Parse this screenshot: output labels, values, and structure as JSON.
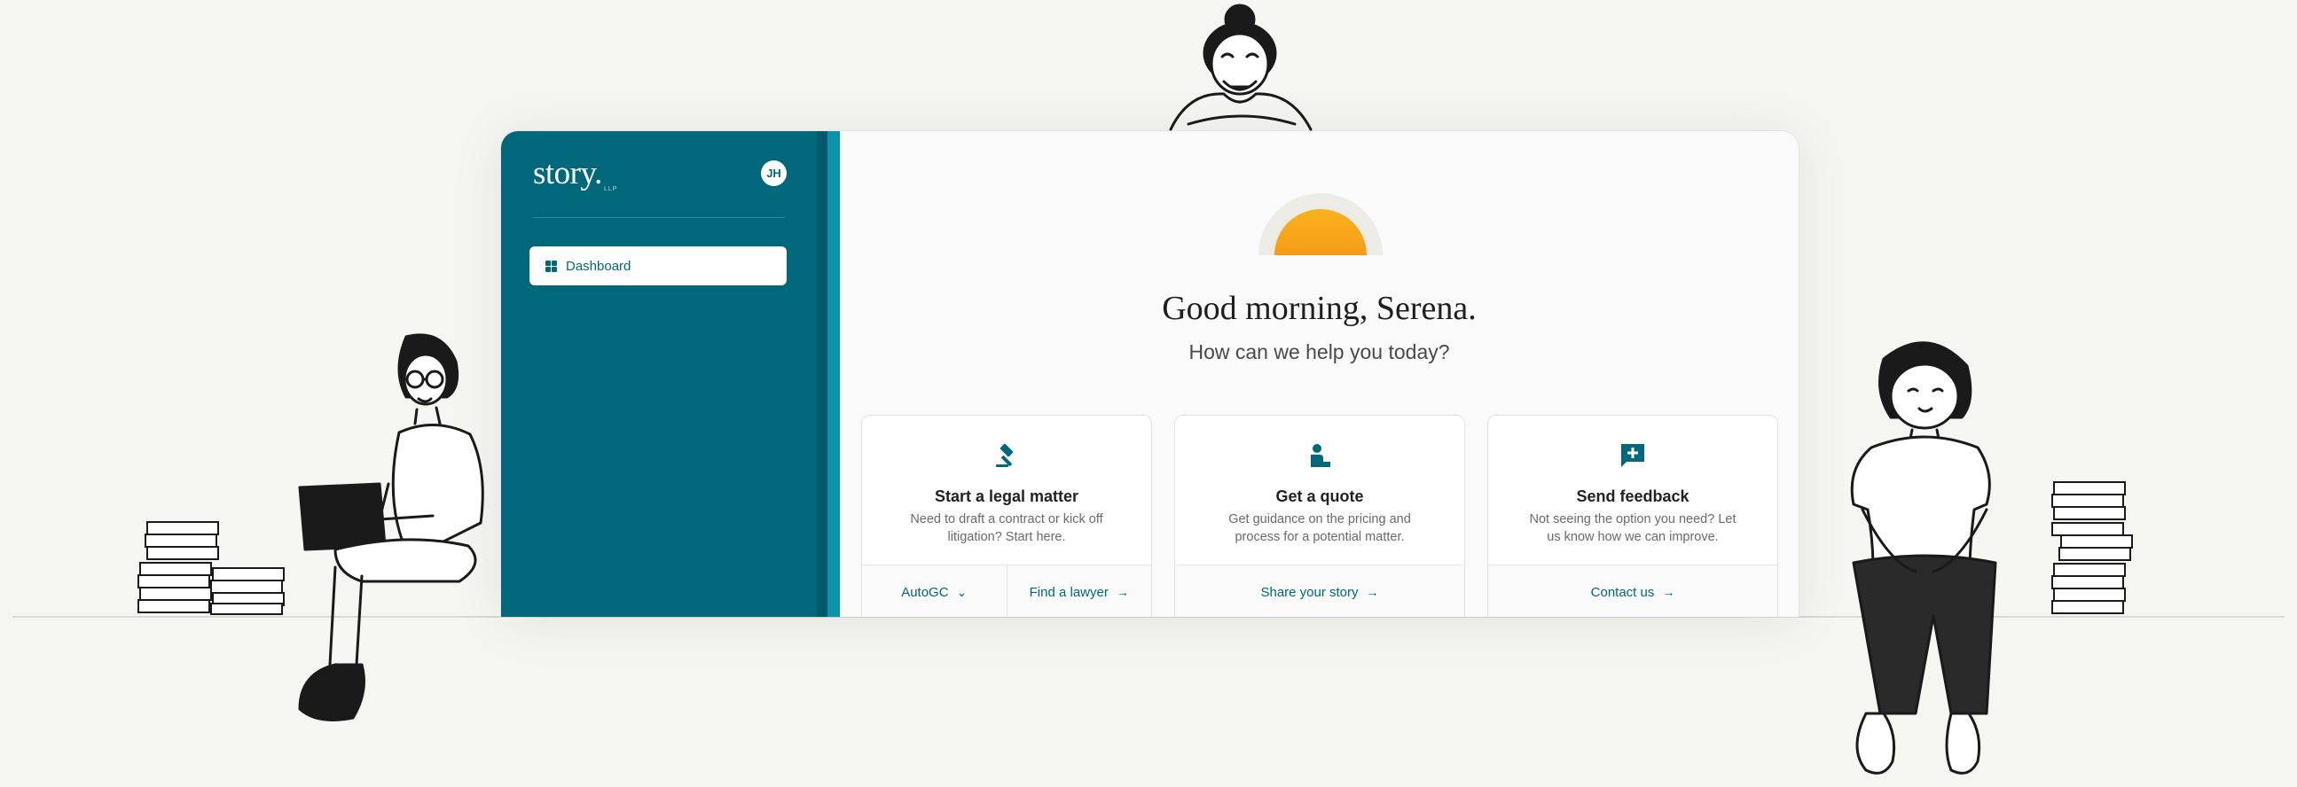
{
  "sidebar": {
    "logo": "story.",
    "logo_sub": "LLP",
    "avatar_initials": "JH",
    "nav": [
      {
        "label": "Dashboard",
        "icon": "dashboard-icon",
        "active": true
      }
    ]
  },
  "main": {
    "greeting": "Good morning, Serena.",
    "subheading": "How can we help you today?",
    "cards": [
      {
        "title": "Start a legal matter",
        "description": "Need to draft a contract or kick off litigation? Start here.",
        "icon": "gavel-icon",
        "actions": [
          {
            "label": "AutoGC",
            "glyph": "⌄"
          },
          {
            "label": "Find a lawyer",
            "glyph": "→"
          }
        ]
      },
      {
        "title": "Get a quote",
        "description": "Get guidance on the pricing and process for a potential matter.",
        "icon": "quote-person-icon",
        "actions": [
          {
            "label": "Share your story",
            "glyph": "→"
          }
        ]
      },
      {
        "title": "Send feedback",
        "description": "Not seeing the option you need? Let us know how we can improve.",
        "icon": "feedback-plus-icon",
        "actions": [
          {
            "label": "Contact us",
            "glyph": "→"
          }
        ]
      }
    ]
  },
  "colors": {
    "brand_teal": "#01677b",
    "sun_orange": "#f7a01a",
    "background": "#f5f5f1"
  }
}
